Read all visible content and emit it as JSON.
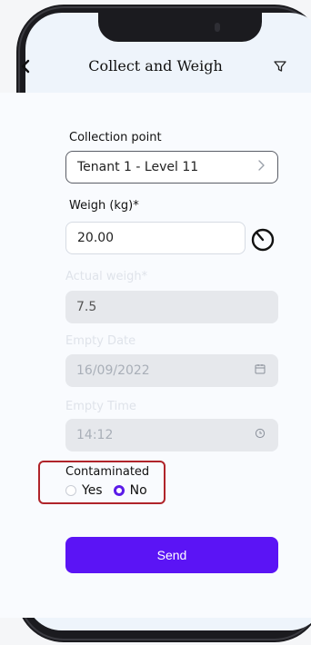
{
  "header": {
    "title": "Collect and Weigh"
  },
  "form": {
    "collection_point": {
      "label": "Collection point",
      "value": "Tenant 1 - Level 11"
    },
    "weigh": {
      "label": "Weigh (kg)*",
      "value": "20.00"
    },
    "actual_weigh": {
      "label": "Actual weigh*",
      "value": "7.5"
    },
    "empty_date": {
      "label": "Empty Date",
      "value": "16/09/2022"
    },
    "empty_time": {
      "label": "Empty Time",
      "value": "14:12"
    },
    "contaminated": {
      "label": "Contaminated",
      "options": [
        "Yes",
        "No"
      ],
      "selected": "No"
    },
    "send_label": "Send"
  },
  "colors": {
    "accent": "#5b14f5",
    "highlight_border": "#b0242a"
  }
}
